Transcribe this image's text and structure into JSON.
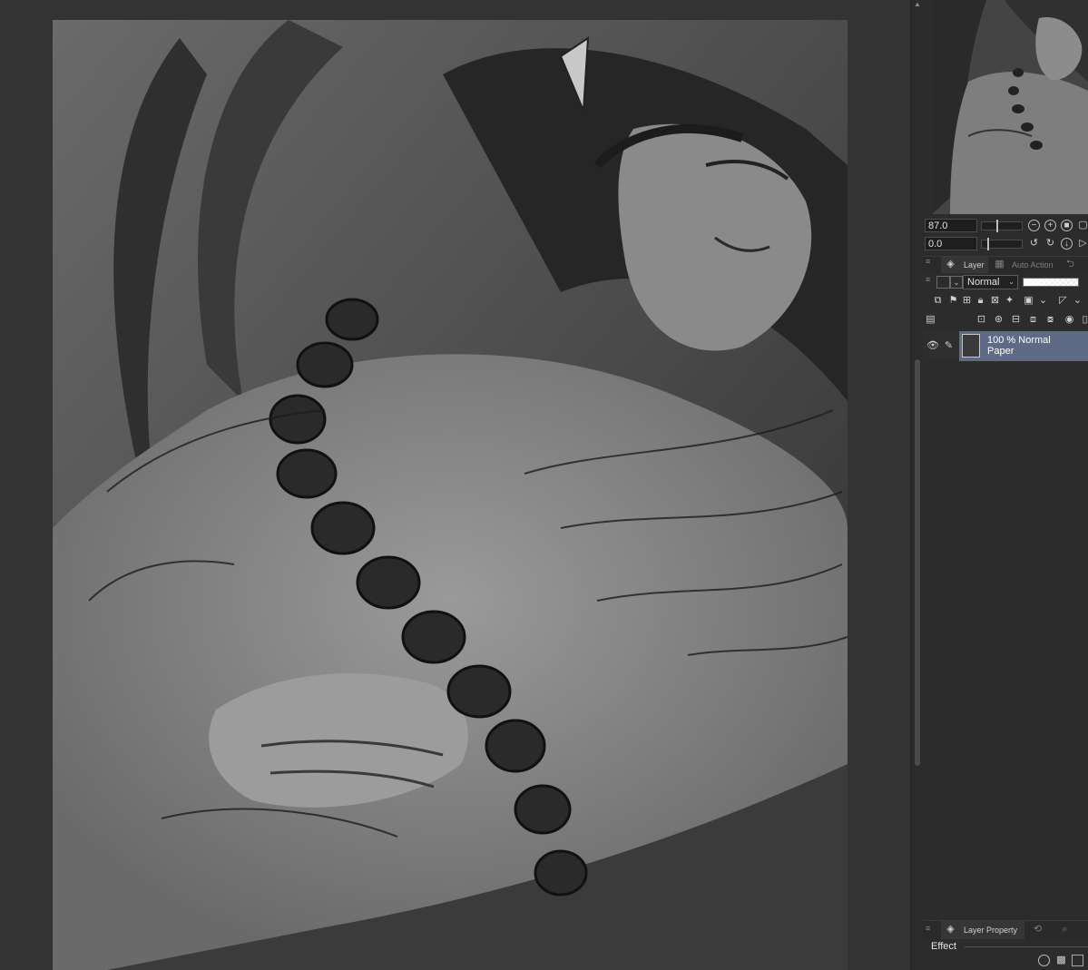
{
  "navigator": {
    "zoom_value": "87.0",
    "rotation_value": "0.0"
  },
  "layer_panel": {
    "tabs": [
      "Layer",
      "Auto Action"
    ],
    "blend_mode": "Normal",
    "layers": [
      {
        "opacity_mode": "100 % Normal",
        "name": "Paper",
        "selected": true
      }
    ]
  },
  "layer_property_panel": {
    "tab": "Layer Property",
    "section_label": "Effect"
  },
  "icons": {
    "zoom_out": "zoom-out-icon",
    "zoom_in": "zoom-in-icon",
    "fit": "fit-screen-icon",
    "rotate_left": "rotate-left-icon",
    "rotate_right": "rotate-right-icon",
    "reset_rotation": "reset-rotation-icon",
    "visibility": "eye-icon",
    "edit": "pencil-icon"
  },
  "colors": {
    "selected_layer": "#5f6a86",
    "panel_bg": "#2c2c2c",
    "canvas_bg": "#333333"
  }
}
